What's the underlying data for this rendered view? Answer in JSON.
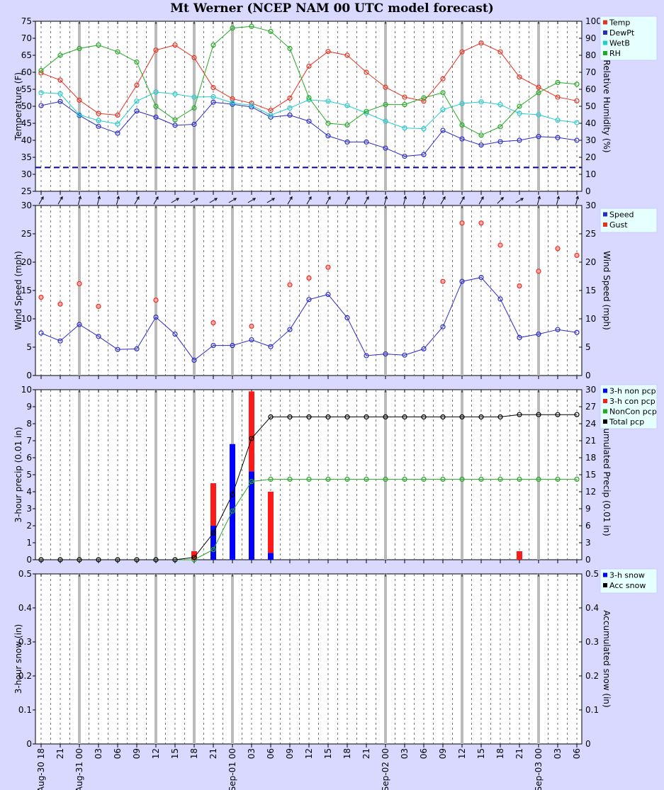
{
  "title": "Mt Werner (NCEP NAM 00 UTC model forecast)",
  "x_labels": [
    "Aug-30 18",
    "21",
    "Aug-31 00",
    "03",
    "06",
    "09",
    "12",
    "15",
    "18",
    "21",
    "Sep-01 00",
    "03",
    "06",
    "09",
    "12",
    "15",
    "18",
    "21",
    "Sep-02 00",
    "03",
    "06",
    "09",
    "12",
    "15",
    "18",
    "21",
    "Sep-03 00",
    "03",
    "06"
  ],
  "chart_data": [
    {
      "type": "line",
      "ylabel": "Temperature (F)",
      "ylabel_right": "Relative Humidity (%)",
      "ylim": [
        25,
        75
      ],
      "ylim_right": [
        0,
        100
      ],
      "legend": [
        "Temp",
        "DewPt",
        "WetB",
        "RH"
      ],
      "freezing_line": 32,
      "series": [
        {
          "name": "Temp",
          "color": "#e8301f",
          "axis": "left",
          "values": [
            59.8,
            57.7,
            51.8,
            47.9,
            47.4,
            56.2,
            66.5,
            68.0,
            64.3,
            55.5,
            52.2,
            50.9,
            48.8,
            52.4,
            61.8,
            66.1,
            65.0,
            60.0,
            55.6,
            52.7,
            51.5,
            58.1,
            66.0,
            68.6,
            66.0,
            58.6,
            55.6,
            52.7,
            51.6
          ]
        },
        {
          "name": "DewPt",
          "color": "#2a2acc",
          "axis": "left",
          "values": [
            50.2,
            51.4,
            47.3,
            44.1,
            42.1,
            48.6,
            46.8,
            44.4,
            44.7,
            51.2,
            50.6,
            49.8,
            46.8,
            47.4,
            45.6,
            41.3,
            39.5,
            39.5,
            37.7,
            35.3,
            35.8,
            42.9,
            40.4,
            38.6,
            39.6,
            40.0,
            41.1,
            40.8,
            40.0
          ]
        },
        {
          "name": "WetB",
          "color": "#22cccc",
          "axis": "left",
          "values": [
            54.0,
            53.7,
            47.5,
            45.8,
            44.8,
            51.5,
            54.2,
            53.6,
            52.7,
            52.8,
            51.0,
            50.3,
            47.4,
            49.5,
            51.9,
            51.5,
            50.2,
            48.0,
            45.6,
            43.6,
            43.4,
            49.0,
            50.8,
            51.3,
            50.5,
            47.9,
            47.5,
            45.9,
            45.2
          ]
        },
        {
          "name": "RH",
          "color": "#22aa22",
          "axis": "right",
          "values": [
            71,
            80,
            84,
            86,
            82,
            76,
            50,
            42,
            49,
            86,
            96,
            97,
            94,
            84,
            55,
            40,
            39,
            47,
            51,
            51,
            55,
            58,
            39,
            33,
            38,
            50,
            58,
            64,
            63
          ]
        }
      ]
    },
    {
      "type": "scatter",
      "ylabel": "Wind Speed (mph)",
      "ylabel_right": "Wind Speed (mph)",
      "ylim": [
        0,
        30
      ],
      "legend": [
        "Speed",
        "Gust"
      ],
      "series": [
        {
          "name": "Speed",
          "color": "#2a2acc",
          "values": [
            7.5,
            6.1,
            9.0,
            6.9,
            4.6,
            4.7,
            10.3,
            7.3,
            2.7,
            5.3,
            5.3,
            6.3,
            5.1,
            8.1,
            13.4,
            14.3,
            10.2,
            3.5,
            3.8,
            3.6,
            4.7,
            8.6,
            16.6,
            17.3,
            13.5,
            6.7,
            7.3,
            8.1,
            7.6
          ]
        },
        {
          "name": "Gust",
          "color": "#e8301f",
          "values": [
            13.8,
            12.6,
            16.2,
            12.2,
            null,
            null,
            13.3,
            null,
            null,
            9.3,
            null,
            8.7,
            null,
            16.0,
            17.2,
            19.1,
            null,
            null,
            null,
            null,
            null,
            16.6,
            26.9,
            26.9,
            23.0,
            15.8,
            18.4,
            22.4,
            21.2
          ]
        }
      ],
      "wind_direction_deg": [
        30,
        30,
        15,
        15,
        15,
        30,
        30,
        60,
        60,
        60,
        60,
        60,
        60,
        30,
        30,
        30,
        30,
        30,
        15,
        15,
        15,
        30,
        30,
        30,
        45,
        60,
        15,
        15,
        15
      ]
    },
    {
      "type": "bar",
      "ylabel": "3-hour precip (0.01 in)",
      "ylabel_right": "Accumulated Precip (0.01 in)",
      "ylim": [
        0,
        10
      ],
      "ylim_right": [
        0,
        30
      ],
      "legend": [
        "3-h non pcp",
        "3-h con pcp",
        "NonCon pcp",
        "Total pcp"
      ],
      "series": [
        {
          "name": "3-h non pcp",
          "color": "#0000ff",
          "values": [
            0,
            0,
            0,
            0,
            0,
            0,
            0,
            0,
            0,
            2.0,
            6.8,
            5.2,
            0.4,
            0,
            0,
            0,
            0,
            0,
            0,
            0,
            0,
            0,
            0,
            0,
            0,
            0,
            0,
            0,
            0
          ]
        },
        {
          "name": "3-h con pcp",
          "color": "#ff1a1a",
          "values": [
            0,
            0,
            0,
            0,
            0,
            0,
            0,
            0,
            0.5,
            2.5,
            0,
            4.7,
            3.6,
            0,
            0,
            0,
            0,
            0,
            0,
            0,
            0,
            0,
            0,
            0,
            0,
            0.5,
            0,
            0,
            0
          ]
        },
        {
          "name": "NonCon pcp",
          "color": "#22aa22",
          "axis": "right",
          "values": [
            0,
            0,
            0,
            0,
            0,
            0,
            0,
            0,
            0,
            1.8,
            8.6,
            13.8,
            14.2,
            14.2,
            14.2,
            14.2,
            14.2,
            14.2,
            14.2,
            14.2,
            14.2,
            14.2,
            14.2,
            14.2,
            14.2,
            14.2,
            14.2,
            14.2,
            14.2
          ]
        },
        {
          "name": "Total pcp",
          "color": "#000000",
          "axis": "right",
          "values": [
            0,
            0,
            0,
            0,
            0,
            0,
            0,
            0,
            0.4,
            4.7,
            11.5,
            21.4,
            25.2,
            25.2,
            25.2,
            25.2,
            25.2,
            25.2,
            25.2,
            25.2,
            25.2,
            25.2,
            25.2,
            25.2,
            25.2,
            25.6,
            25.6,
            25.6,
            25.6
          ]
        }
      ]
    },
    {
      "type": "line",
      "ylabel": "3-hour snow (in)",
      "ylabel_right": "Accumulated snow (in)",
      "ylim": [
        0,
        0.5
      ],
      "legend": [
        "3-h snow",
        "Acc snow"
      ],
      "series": [
        {
          "name": "3-h snow",
          "color": "#0000ff",
          "values": []
        },
        {
          "name": "Acc snow",
          "color": "#000000",
          "values": []
        }
      ]
    }
  ]
}
